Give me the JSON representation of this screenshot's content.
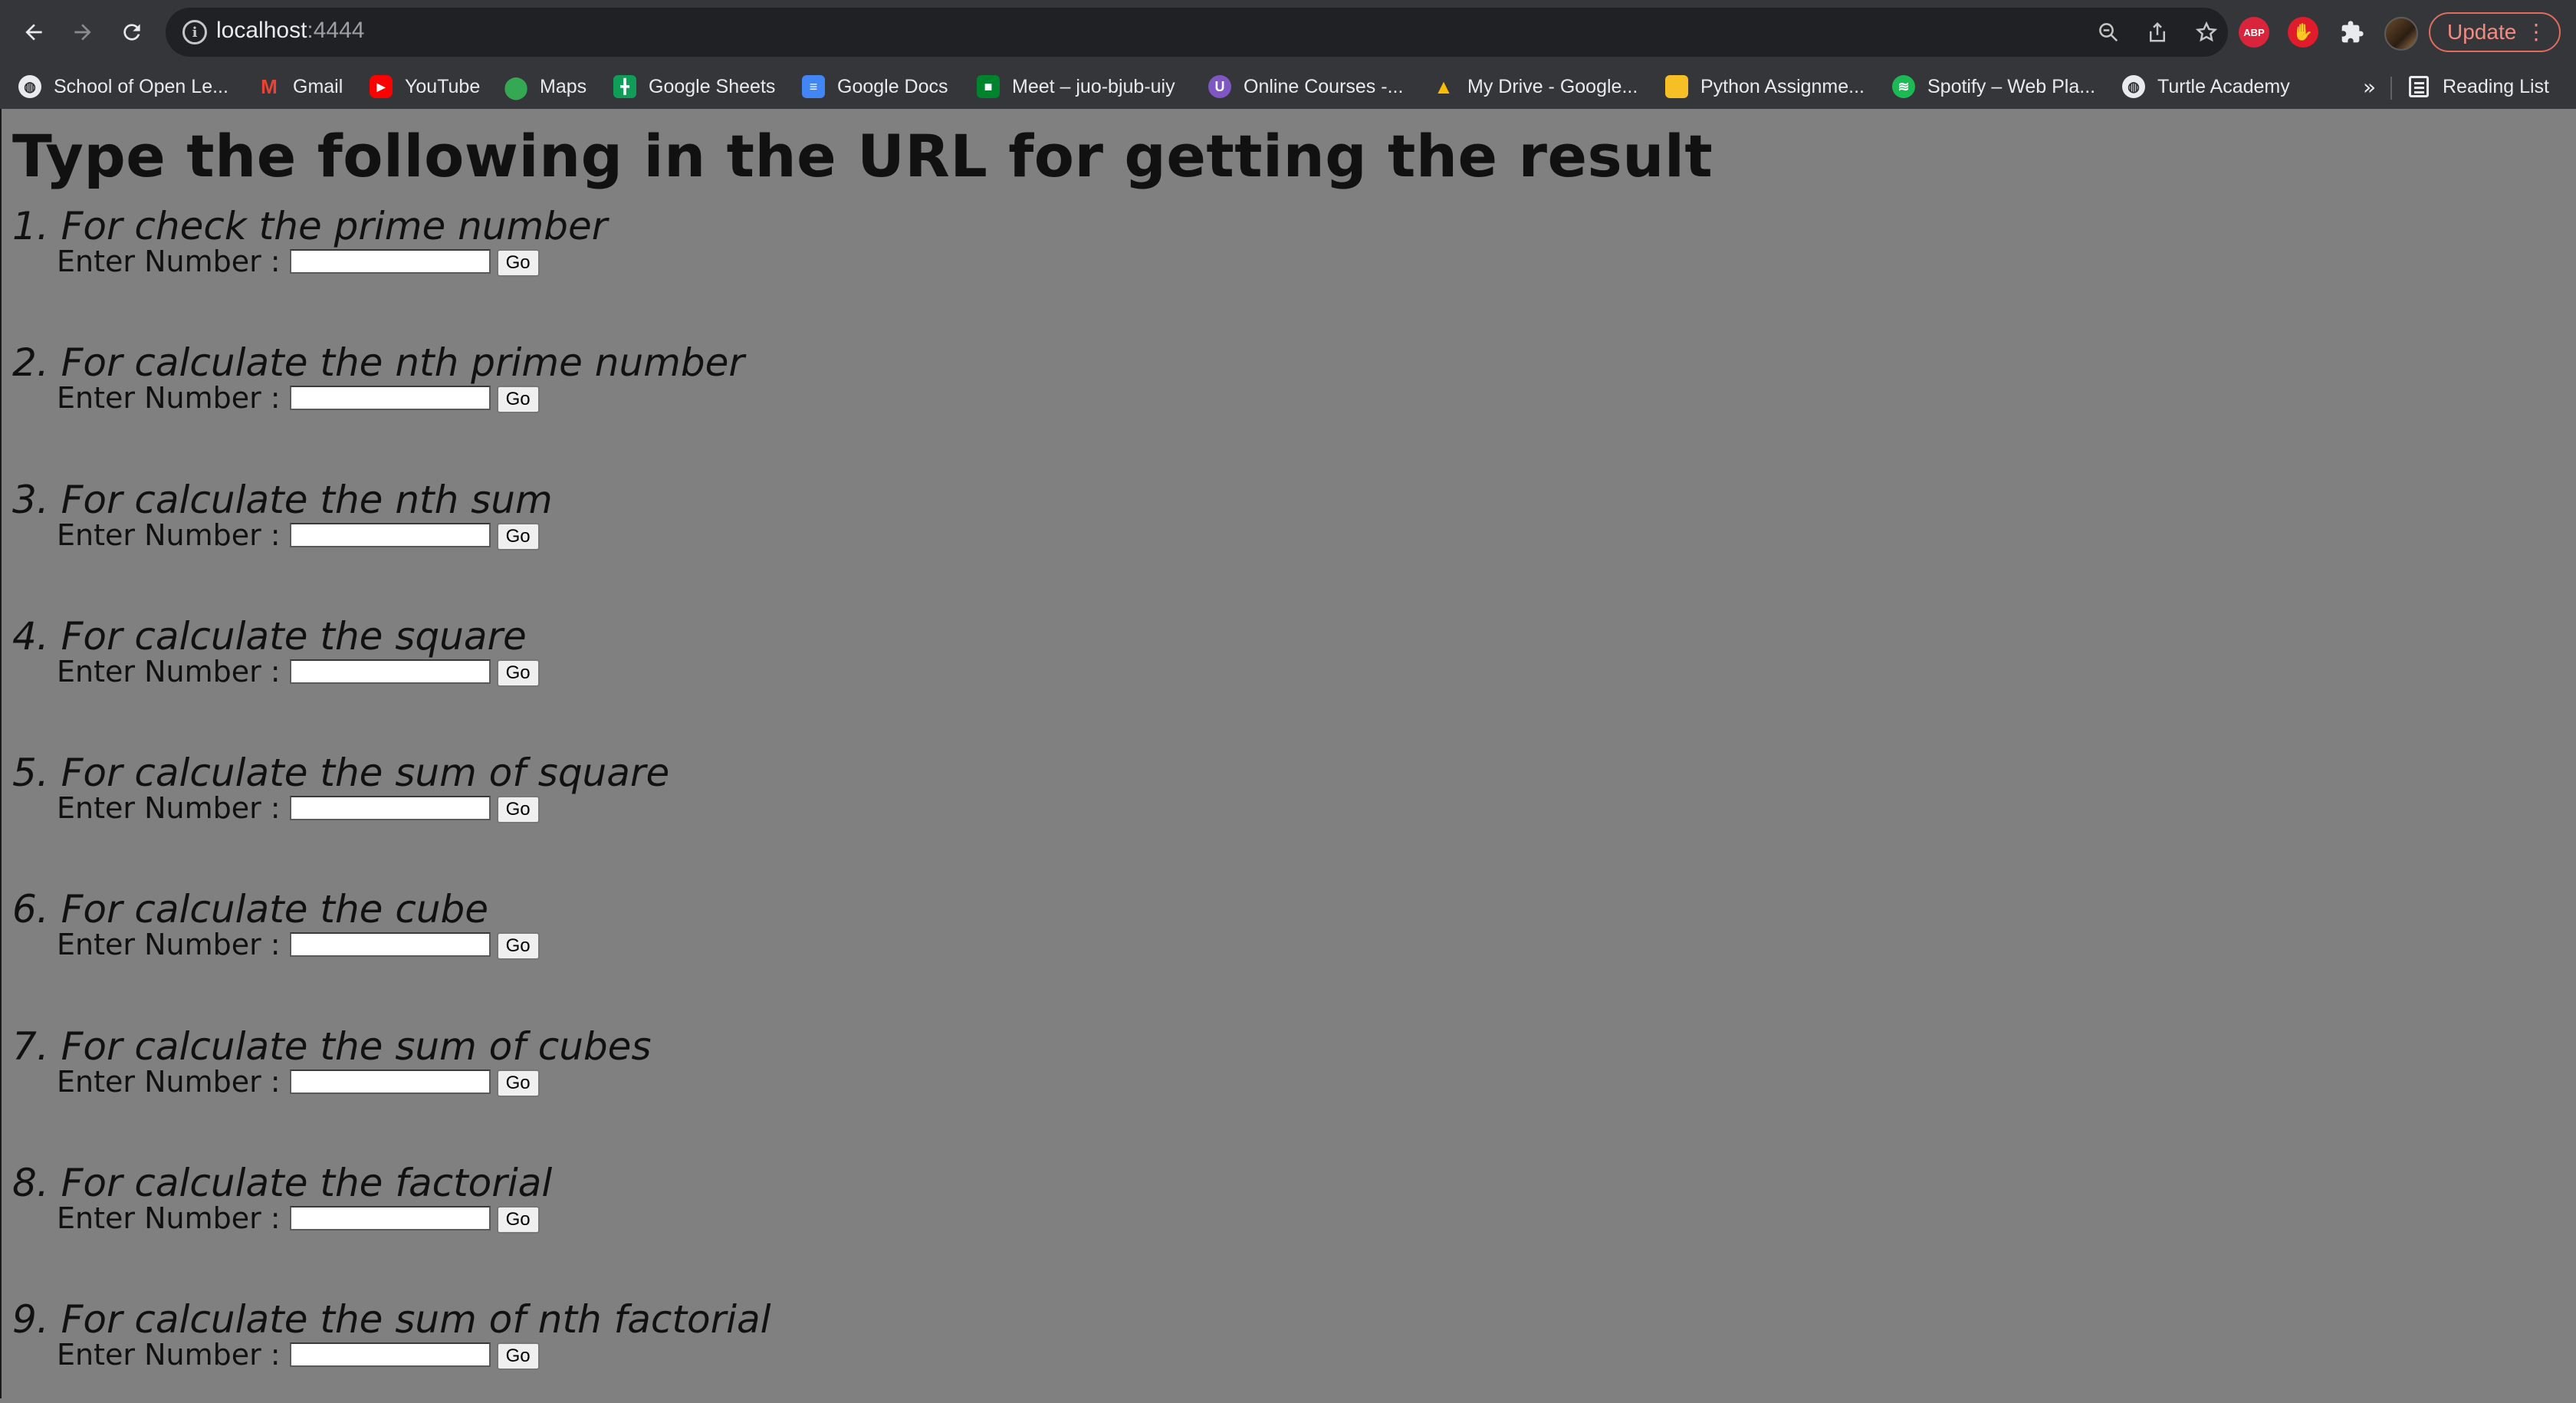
{
  "browser": {
    "url_host": "localhost",
    "url_port": ":4444",
    "update_label": "Update",
    "ext_abp_label": "ABP",
    "bookmarks": [
      {
        "label": "School of Open Le...",
        "icon": "globe-icon"
      },
      {
        "label": "Gmail",
        "icon": "gmail-icon"
      },
      {
        "label": "YouTube",
        "icon": "youtube-icon"
      },
      {
        "label": "Maps",
        "icon": "maps-icon"
      },
      {
        "label": "Google Sheets",
        "icon": "google-sheets-icon"
      },
      {
        "label": "Google Docs",
        "icon": "google-docs-icon"
      },
      {
        "label": "Meet – juo-bjub-uiy",
        "icon": "google-meet-icon"
      },
      {
        "label": "Online Courses -...",
        "icon": "online-courses-icon"
      },
      {
        "label": "My Drive - Google...",
        "icon": "google-drive-icon"
      },
      {
        "label": "Python Assignme...",
        "icon": "google-slides-icon"
      },
      {
        "label": "Spotify – Web Pla...",
        "icon": "spotify-icon"
      },
      {
        "label": "Turtle Academy",
        "icon": "globe-icon"
      }
    ],
    "more_bookmarks": "»",
    "reading_list_label": "Reading List"
  },
  "page": {
    "title": "Type the following in the URL for getting the result",
    "field_label": "Enter Number :",
    "go_label": "Go",
    "sections": [
      {
        "heading": "1. For check the prime number"
      },
      {
        "heading": "2. For calculate the nth prime number"
      },
      {
        "heading": "3. For calculate the nth sum"
      },
      {
        "heading": "4. For calculate the square"
      },
      {
        "heading": "5. For calculate the sum of square"
      },
      {
        "heading": "6. For calculate the cube"
      },
      {
        "heading": "7. For calculate the sum of cubes"
      },
      {
        "heading": "8. For calculate the factorial"
      },
      {
        "heading": "9. For calculate the sum of nth factorial"
      }
    ]
  }
}
